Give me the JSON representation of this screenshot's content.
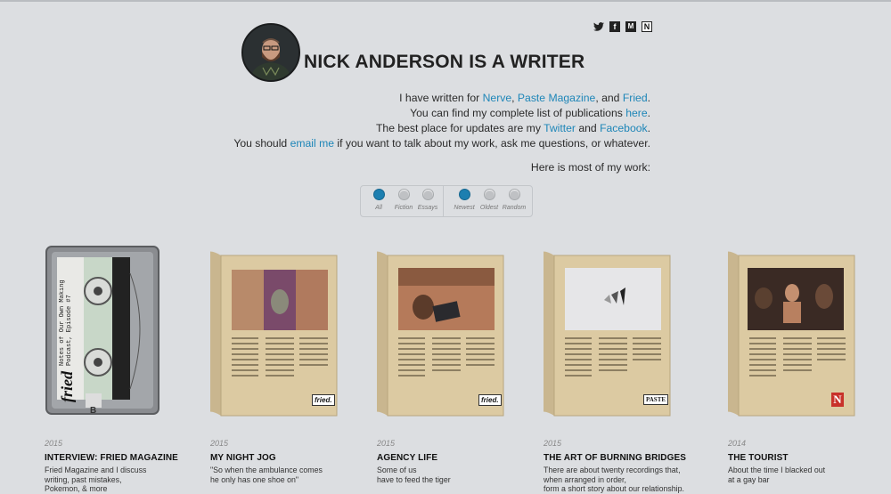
{
  "header": {
    "title": "NICK ANDERSON IS A WRITER"
  },
  "social": [
    {
      "name": "twitter-icon",
      "glyph": "🐦"
    },
    {
      "name": "facebook-icon",
      "glyph": "f"
    },
    {
      "name": "medium-icon",
      "glyph": "M"
    },
    {
      "name": "newspaper-icon",
      "glyph": "N"
    }
  ],
  "intro": {
    "line1_pre": "I have written for ",
    "link_nerve": "Nerve",
    "sep1": ", ",
    "link_paste": "Paste Magazine",
    "sep2": ", and ",
    "link_fried": "Fried",
    "end1": ".",
    "line2_pre": "You can find my complete list of publications ",
    "link_here": "here",
    "end2": ".",
    "line3_pre": "The best place for updates are my ",
    "link_twitter": "Twitter",
    "line3_and": " and ",
    "link_facebook": "Facebook",
    "end3": ".",
    "line4_pre": "You should ",
    "link_email": "email me",
    "line4_post": " if you want to talk about my work, ask me questions, or whatever.",
    "most": "Here is most of my work:"
  },
  "filters": {
    "type": [
      {
        "label": "All",
        "active": true
      },
      {
        "label": "Fiction",
        "active": false
      },
      {
        "label": "Essays",
        "active": false
      }
    ],
    "sort": [
      {
        "label": "Newest",
        "active": true
      },
      {
        "label": "Oldest",
        "active": false
      },
      {
        "label": "Random",
        "active": false
      }
    ]
  },
  "works": [
    {
      "year": "2015",
      "title": "INTERVIEW: FRIED MAGAZINE",
      "desc": [
        "Fried Magazine and I discuss",
        "writing, past mistakes,",
        "Pokemon, & more"
      ],
      "kind": "cassette",
      "badge": "",
      "cassette_text": "Notes of Our Own Making Podcast, Episode #7",
      "cassette_brand": "fried",
      "cassette_side": "B"
    },
    {
      "year": "2015",
      "title": "MY NIGHT JOG",
      "desc": [
        "\"So when the ambulance comes",
        "he only has one shoe on\""
      ],
      "kind": "magazine",
      "badge": "fried.",
      "image": "faces"
    },
    {
      "year": "2015",
      "title": "AGENCY LIFE",
      "desc": [
        "Some of us",
        "have to feed the tiger"
      ],
      "kind": "magazine",
      "badge": "fried.",
      "image": "laptop"
    },
    {
      "year": "2015",
      "title": "THE ART OF BURNING BRIDGES",
      "desc": [
        "There are about twenty recordings that,",
        "when arranged in order,",
        "form a short story about our relationship."
      ],
      "kind": "magazine",
      "badge": "PASTE",
      "image": "shards"
    },
    {
      "year": "2014",
      "title": "THE TOURIST",
      "desc": [
        "About the time I blacked out",
        "at a gay bar"
      ],
      "kind": "magazine",
      "badge": "N",
      "image": "bar"
    }
  ]
}
